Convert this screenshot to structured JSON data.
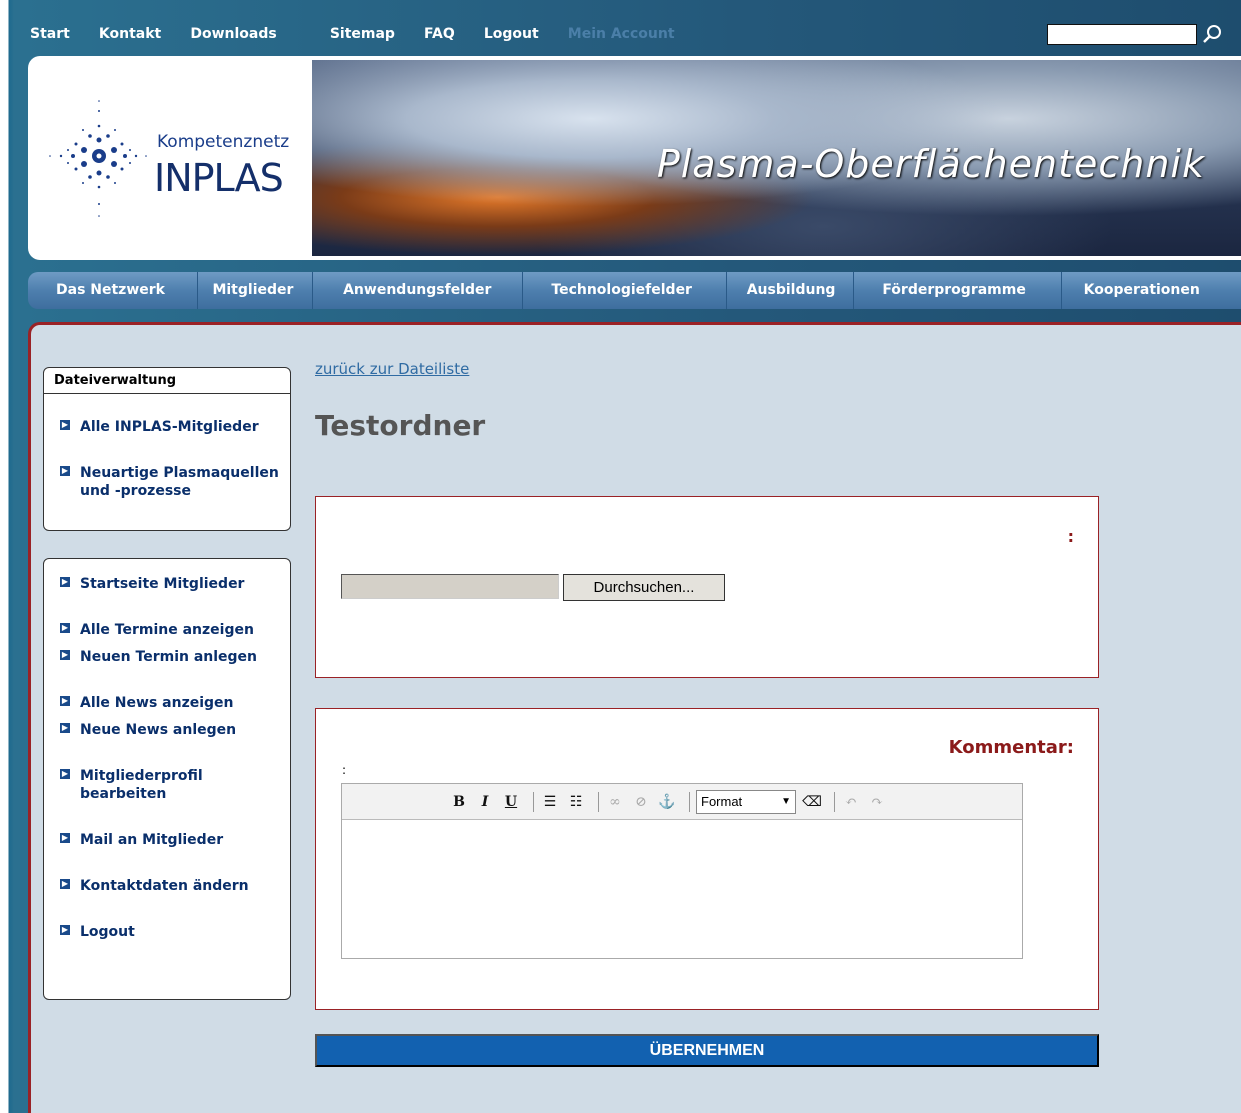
{
  "topnav": {
    "links": [
      "Start",
      "Kontakt",
      "Downloads",
      "Sitemap",
      "FAQ",
      "Logout",
      "Mein Account"
    ]
  },
  "header": {
    "logo_small": "Kompetenznetz",
    "logo_big": "INPLAS",
    "banner_title": "Plasma-Oberflächentechnik"
  },
  "mainnav": [
    "Das Netzwerk",
    "Mitglieder",
    "Anwendungsfelder",
    "Technologiefelder",
    "Ausbildung",
    "Förderprogramme",
    "Kooperationen"
  ],
  "sidebar": {
    "box1_title": "Dateiverwaltung",
    "box1_items": [
      "Alle INPLAS-Mitglieder",
      "Neuartige Plasmaquellen und -prozesse"
    ],
    "box2_items": [
      "Startseite Mitglieder",
      "Alle Termine anzeigen",
      "Neuen Termin anlegen",
      "Alle News anzeigen",
      "Neue News anlegen",
      "Mitgliederprofil bearbeiten",
      "Mail an Mitglieder",
      "Kontaktdaten ändern",
      "Logout"
    ]
  },
  "main": {
    "backlink": "zurück zur Dateiliste",
    "heading": "Testordner",
    "upload_colon": ":",
    "browse_label": "Durchsuchen...",
    "comment_label": "Kommentar:",
    "comment_colon": ":",
    "format_label": "Format",
    "submit_label": "ÜBERNEHMEN"
  },
  "colors": {
    "accent_red": "#9a2226",
    "nav_blue": "#4e7fae",
    "submit_blue": "#1261b0",
    "content_bg": "#d0dce6"
  }
}
